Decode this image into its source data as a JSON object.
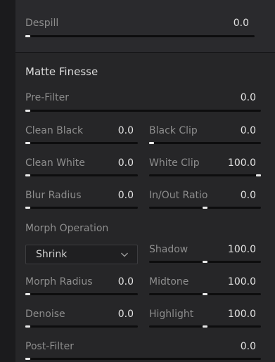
{
  "despill": {
    "label": "Despill",
    "value": "0.0",
    "level": 0.0
  },
  "matte_finesse": {
    "title": "Matte Finesse",
    "pre_filter": {
      "label": "Pre-Filter",
      "value": "0.0",
      "level": 0.0
    },
    "clean_black": {
      "label": "Clean Black",
      "value": "0.0",
      "level": 0.0
    },
    "black_clip": {
      "label": "Black Clip",
      "value": "0.0",
      "level": 0.0
    },
    "clean_white": {
      "label": "Clean White",
      "value": "0.0",
      "level": 0.0
    },
    "white_clip": {
      "label": "White Clip",
      "value": "100.0",
      "level": 1.0
    },
    "blur_radius": {
      "label": "Blur Radius",
      "value": "0.0",
      "level": 0.0
    },
    "in_out_ratio": {
      "label": "In/Out Ratio",
      "value": "0.0",
      "level": 0.5
    },
    "morph_operation": {
      "label": "Morph Operation",
      "selected": "Shrink"
    },
    "shadow": {
      "label": "Shadow",
      "value": "100.0",
      "level": 0.5
    },
    "morph_radius": {
      "label": "Morph Radius",
      "value": "0.0",
      "level": 0.0
    },
    "midtone": {
      "label": "Midtone",
      "value": "100.0",
      "level": 0.5
    },
    "denoise": {
      "label": "Denoise",
      "value": "0.0",
      "level": 0.0
    },
    "highlight": {
      "label": "Highlight",
      "value": "100.0",
      "level": 0.5
    },
    "post_filter": {
      "label": "Post-Filter",
      "value": "0.0",
      "level": 0.0
    }
  },
  "colors": {
    "panel": "#262628",
    "track": "#0d0d0e",
    "handle": "#e9e9e9",
    "label": "#8d8d8d",
    "value": "#e3e3e3"
  }
}
